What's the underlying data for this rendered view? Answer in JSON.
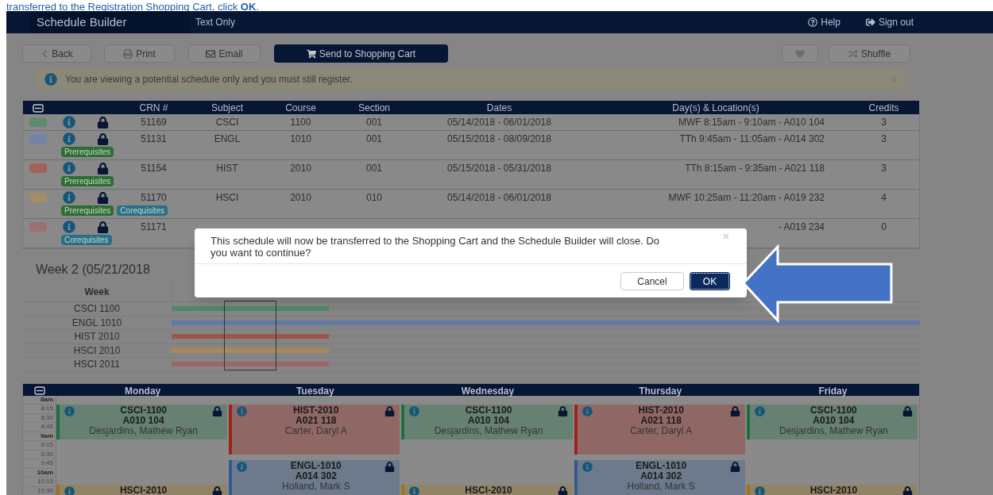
{
  "instruction": "transferred to the Registration Shopping Cart, click **OK**.",
  "header": {
    "title": "Schedule Builder",
    "text_only": "Text Only",
    "help": "Help",
    "sign_out": "Sign out"
  },
  "toolbar": {
    "back": "Back",
    "print": "Print",
    "email": "Email",
    "send": "Send to Shopping Cart",
    "shuffle": "Shuffle"
  },
  "alert": {
    "text": "You are viewing a potential schedule only and you must still register."
  },
  "table": {
    "columns": [
      "CRN #",
      "Subject",
      "Course",
      "Section",
      "Dates",
      "Day(s) & Location(s)",
      "Credits"
    ],
    "rows": [
      {
        "color": "#5e8a70",
        "crn": "51169",
        "subject": "CSCI",
        "course": "1100",
        "section": "001",
        "dates": "05/14/2018 - 06/01/2018",
        "days_location": "MWF 8:15am - 9:10am - A010 104",
        "credits": "3",
        "tags": []
      },
      {
        "color": "#7183a6",
        "crn": "51131",
        "subject": "ENGL",
        "course": "1010",
        "section": "001",
        "dates": "05/15/2018 - 08/09/2018",
        "days_location": "TTh 9:45am - 11:05am - A014 302",
        "credits": "3",
        "tags": [
          {
            "kind": "prereq",
            "label": "Prerequisites"
          }
        ]
      },
      {
        "color": "#a0625a",
        "crn": "51154",
        "subject": "HIST",
        "course": "2010",
        "section": "001",
        "dates": "05/15/2018 - 05/31/2018",
        "days_location": "TTh 8:15am - 9:35am - A021 118",
        "credits": "3",
        "tags": [
          {
            "kind": "prereq",
            "label": "Prerequisites"
          }
        ]
      },
      {
        "color": "#a38d66",
        "crn": "51170",
        "subject": "HSCI",
        "course": "2010",
        "section": "010",
        "dates": "05/14/2018 - 06/01/2018",
        "days_location": "MWF 10:25am - 11:20am - A019 232",
        "credits": "4",
        "tags": [
          {
            "kind": "prereq",
            "label": "Prerequisites"
          },
          {
            "kind": "coreq",
            "label": "Corequisites"
          }
        ]
      },
      {
        "color": "#9a7070",
        "crn": "51171",
        "days_location": "- A019 234",
        "credits": "0",
        "tags": [
          {
            "kind": "coreq",
            "label": "Corequisites"
          }
        ]
      }
    ]
  },
  "week": {
    "title": "Week 2 (05/21/2018",
    "column": "Week",
    "courses": [
      {
        "label": "CSCI 1100",
        "color": "#4f8a66",
        "level": 0.21
      },
      {
        "label": "ENGL 1010",
        "color": "#6478a6",
        "level": 1
      },
      {
        "label": "HIST 2010",
        "color": "#a0544c",
        "level": 0.21
      },
      {
        "label": "HSCI 2010",
        "color": "#a88a58",
        "level": 0.21
      },
      {
        "label": "HSCI 2011",
        "color": "#9c6666",
        "level": 0.21
      }
    ]
  },
  "calendar": {
    "times": [
      {
        "label": "8am",
        "kind": "hour"
      },
      {
        "label": "8:15",
        "kind": "quarter"
      },
      {
        "label": "8:30",
        "kind": "quarter"
      },
      {
        "label": "8:45",
        "kind": "quarter"
      },
      {
        "label": "9am",
        "kind": "hour"
      },
      {
        "label": "9:15",
        "kind": "quarter"
      },
      {
        "label": "9:30",
        "kind": "quarter"
      },
      {
        "label": "9:45",
        "kind": "quarter"
      },
      {
        "label": "10am",
        "kind": "hour"
      },
      {
        "label": "10:15",
        "kind": "quarter"
      },
      {
        "label": "10:30",
        "kind": "quarter"
      }
    ],
    "days": [
      {
        "name": "Monday",
        "events": [
          {
            "kind": "short",
            "title": "CSCI-1100",
            "room": "A010 104",
            "instructor": "Desjardins, Mathew Ryan",
            "color": "#1f6e40"
          },
          {
            "kind": "open",
            "title": "HSCI-2010",
            "color": "#a0741e"
          }
        ]
      },
      {
        "name": "Tuesday",
        "events": [
          {
            "kind": "long",
            "title": "HIST-2010",
            "room": "A021 118",
            "instructor": "Carter, Daryl A",
            "color": "#9a241c"
          },
          {
            "kind": "open",
            "title": "ENGL-1010",
            "room": "A014 302",
            "instructor": "Holland, Mark S",
            "color": "#34598c"
          }
        ]
      },
      {
        "name": "Wednesday",
        "events": [
          {
            "kind": "short",
            "title": "CSCI-1100",
            "room": "A010 104",
            "instructor": "Desjardins, Mathew Ryan",
            "color": "#1f6e40"
          },
          {
            "kind": "open",
            "title": "HSCI-2010",
            "color": "#a0741e"
          }
        ]
      },
      {
        "name": "Thursday",
        "events": [
          {
            "kind": "long",
            "title": "HIST-2010",
            "room": "A021 118",
            "instructor": "Carter, Daryl A",
            "color": "#9a241c"
          },
          {
            "kind": "open",
            "title": "ENGL-1010",
            "room": "A014 302",
            "instructor": "Holland, Mark S",
            "color": "#34598c"
          }
        ]
      },
      {
        "name": "Friday",
        "events": [
          {
            "kind": "short",
            "title": "CSCI-1100",
            "room": "A010 104",
            "instructor": "Desjardins, Mathew Ryan",
            "color": "#1f6e40"
          },
          {
            "kind": "open",
            "title": "HSCI-2010",
            "color": "#a0741e"
          }
        ]
      }
    ]
  },
  "dialog": {
    "message": "This schedule will now be transferred to the Shopping Cart and the Schedule Builder will close. Do you want to continue?",
    "cancel": "Cancel",
    "ok": "OK"
  }
}
